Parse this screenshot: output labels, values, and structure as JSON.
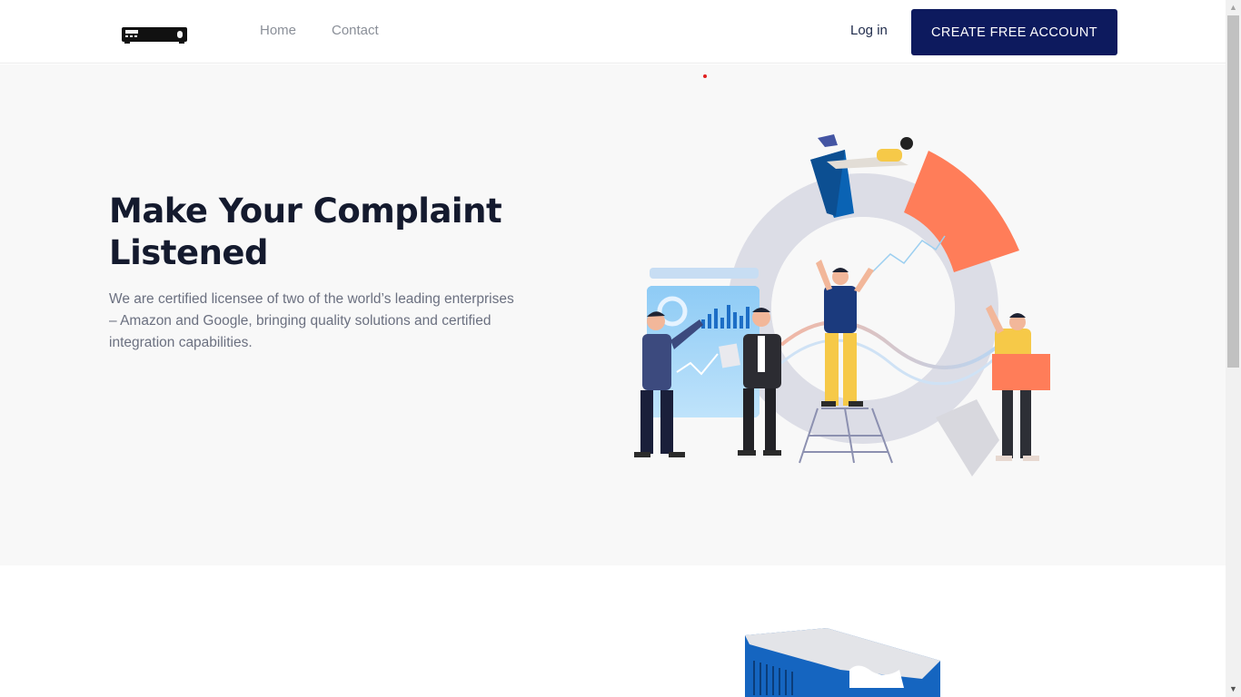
{
  "header": {
    "logo_alt": "logo",
    "nav": {
      "home": "Home",
      "contact": "Contact"
    },
    "login": "Log in",
    "cta": "CREATE FREE ACCOUNT"
  },
  "hero": {
    "title": "Make Your Complaint Listened",
    "text": "We are certified licensee of two of the world’s leading enterprises – Amazon and Google, bringing quality solutions and certified integration capabilities."
  },
  "colors": {
    "brand_navy": "#0d1a5e",
    "accent_blue": "#1565c0",
    "accent_orange": "#ff7d59",
    "hero_bg": "#f8f8f8"
  },
  "scrollbar": {
    "up": "▲",
    "down": "▼"
  }
}
